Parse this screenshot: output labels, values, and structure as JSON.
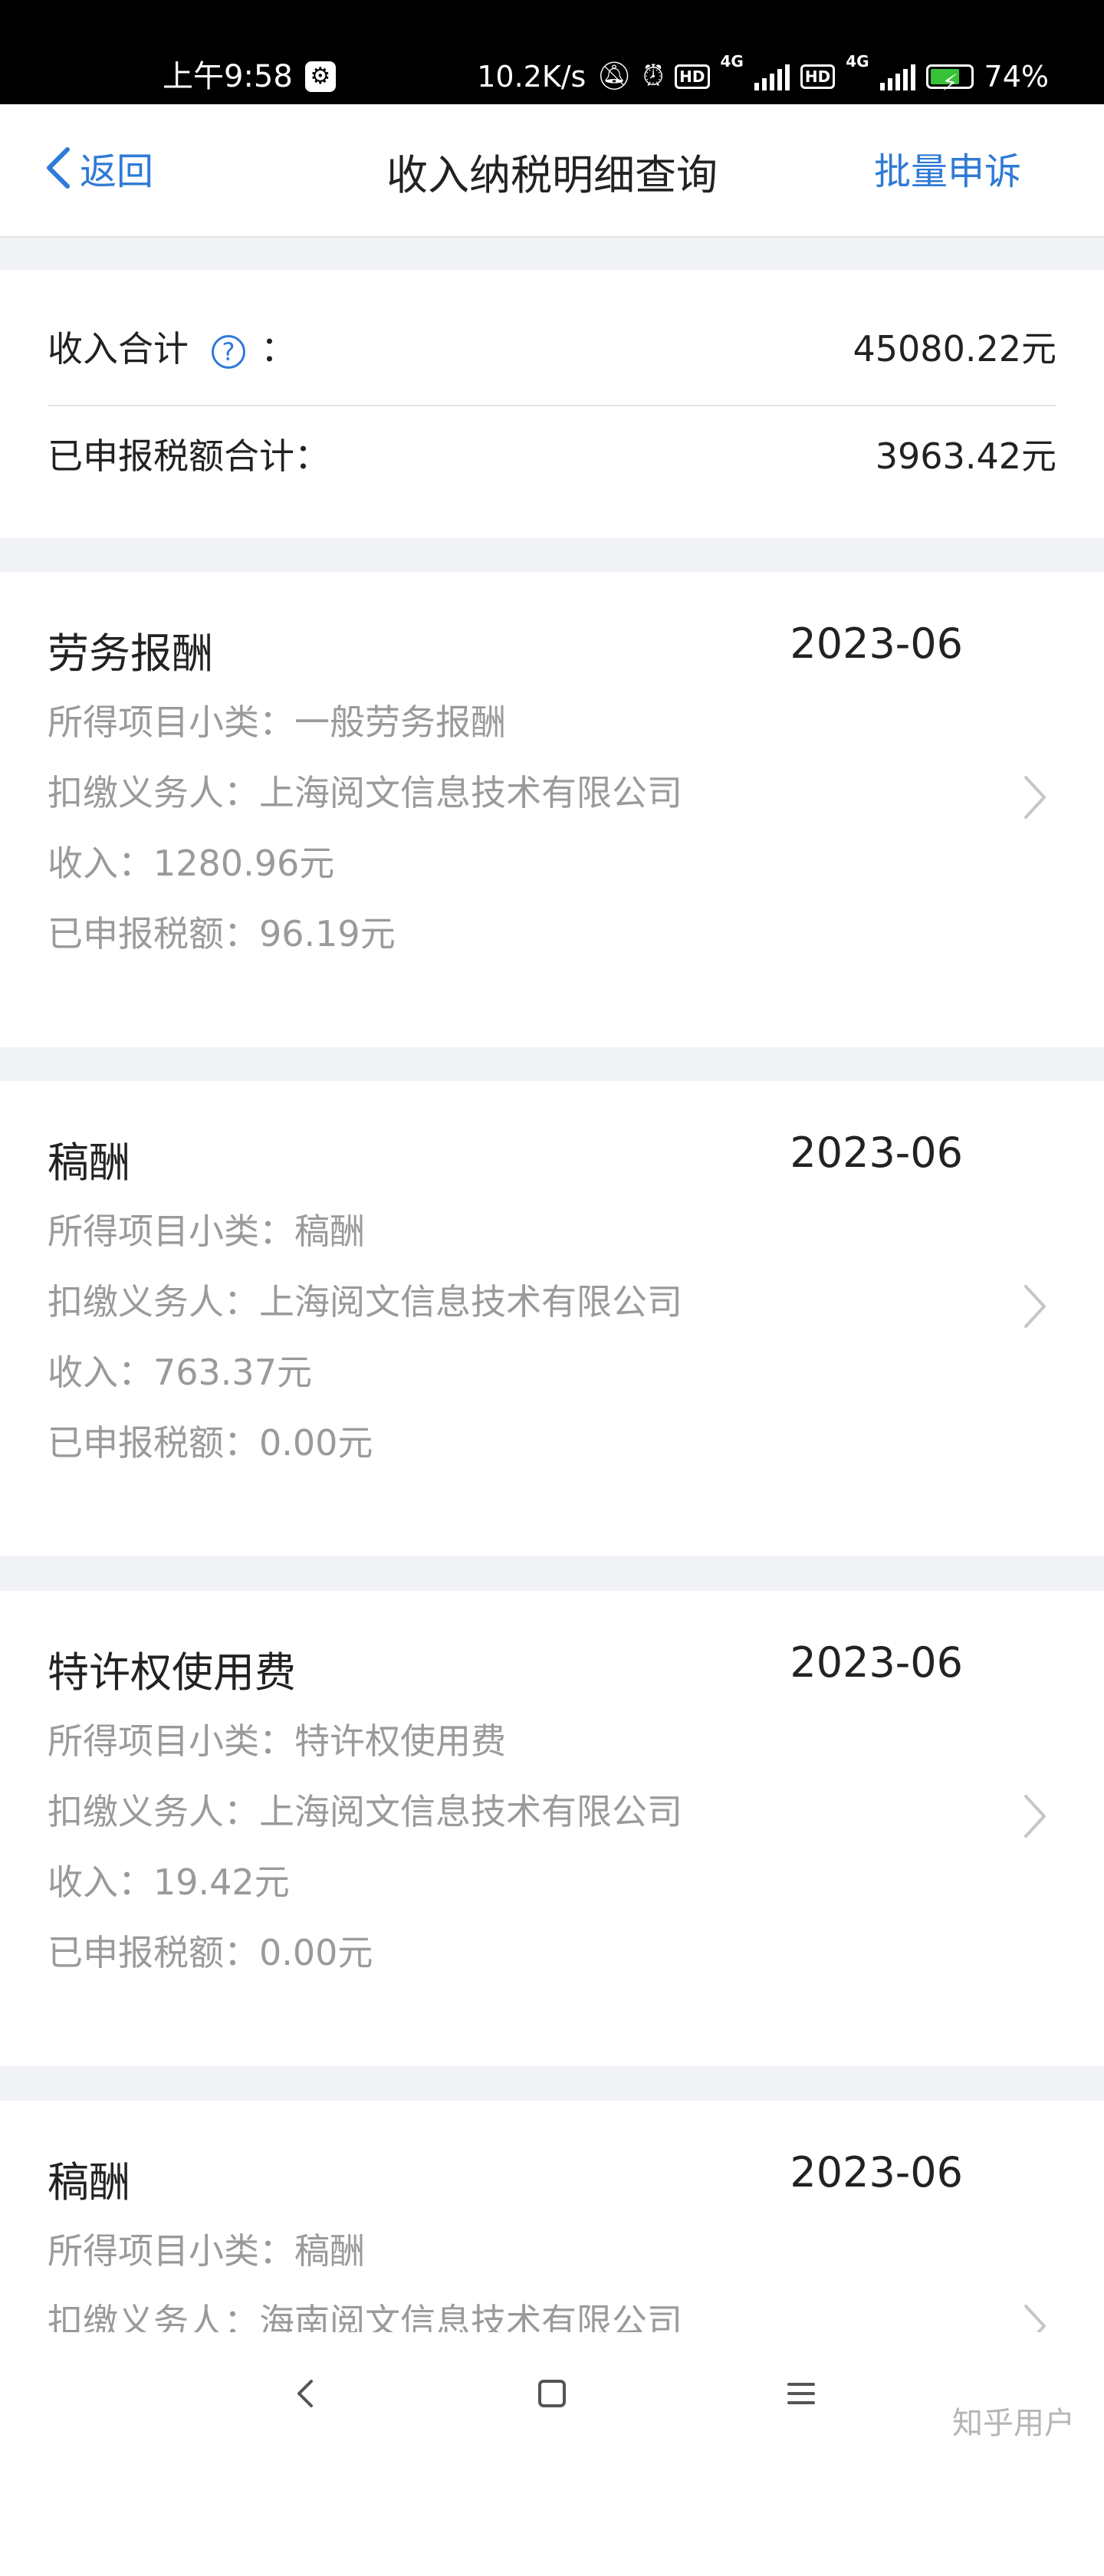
{
  "status_bar": {
    "time": "上午9:58",
    "net_speed": "10.2K/s",
    "sim1": "4G",
    "sim2": "4G",
    "hd": "HD",
    "battery": "74%",
    "battery_level": 0.74
  },
  "header": {
    "back_label": "返回",
    "title": "收入纳税明细查询",
    "action_label": "批量申诉"
  },
  "summary": {
    "income_label": "收入合计",
    "income_help": "?",
    "income_colon": "：",
    "income_value": "45080.22元",
    "tax_label": "已申报税额合计：",
    "tax_value": "3963.42元"
  },
  "records": [
    {
      "category": "劳务报酬",
      "date": "2023-06",
      "subtype": "所得项目小类：一般劳务报酬",
      "payer": "扣缴义务人：上海阅文信息技术有限公司",
      "income": "收入：1280.96元",
      "tax": "已申报税额：96.19元"
    },
    {
      "category": "稿酬",
      "date": "2023-06",
      "subtype": "所得项目小类：稿酬",
      "payer": "扣缴义务人：上海阅文信息技术有限公司",
      "income": "收入：763.37元",
      "tax": "已申报税额：0.00元"
    },
    {
      "category": "特许权使用费",
      "date": "2023-06",
      "subtype": "所得项目小类：特许权使用费",
      "payer": "扣缴义务人：上海阅文信息技术有限公司",
      "income": "收入：19.42元",
      "tax": "已申报税额：0.00元"
    },
    {
      "category": "稿酬",
      "date": "2023-06",
      "subtype": "所得项目小类：稿酬",
      "payer": "扣缴义务人：海南阅文信息技术有限公司",
      "income": "",
      "tax": ""
    }
  ],
  "watermark": "知乎用户",
  "colors": {
    "accent": "#2f7ad6",
    "secondary_text": "#9a9a9a",
    "page_bg": "#f1f2f6"
  }
}
